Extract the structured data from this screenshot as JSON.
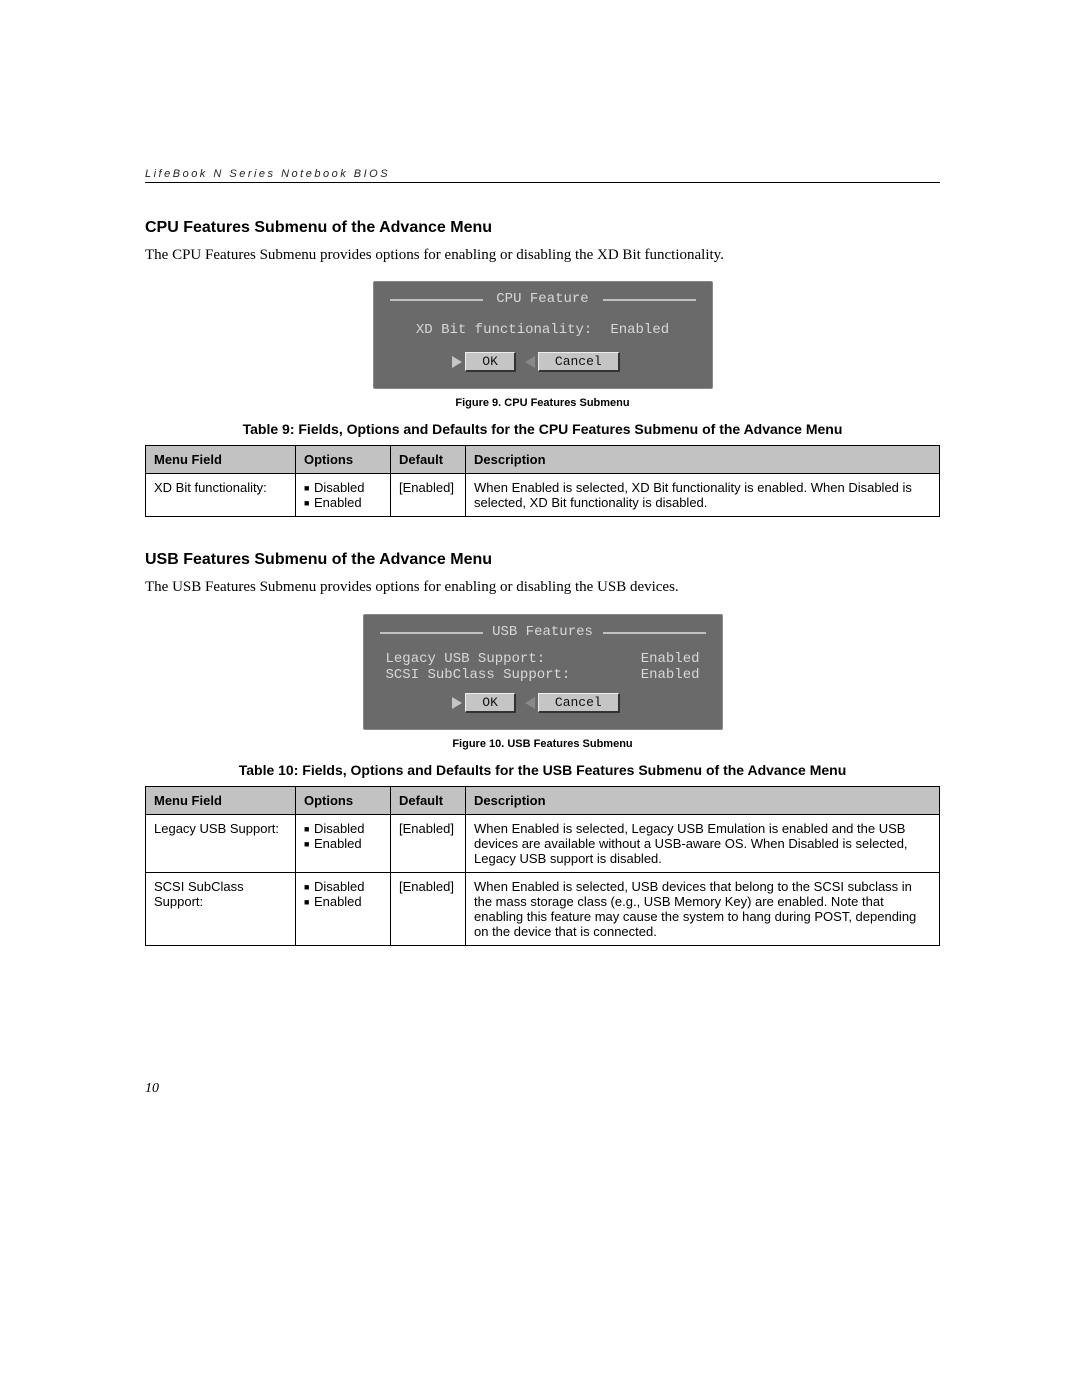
{
  "header": "LifeBook N Series Notebook BIOS",
  "section1": {
    "heading": "CPU Features Submenu of the Advance Menu",
    "body": "The CPU Features Submenu provides options for enabling or disabling the XD Bit functionality.",
    "bios": {
      "title": "CPU Feature",
      "fields": [
        {
          "label": "XD Bit functionality:",
          "value": "Enabled"
        }
      ],
      "ok": "OK",
      "cancel": "Cancel"
    },
    "fig_caption": "Figure 9.  CPU Features Submenu",
    "table_caption": "Table 9: Fields, Options and Defaults for the CPU Features Submenu of the Advance Menu",
    "table_headers": [
      "Menu Field",
      "Options",
      "Default",
      "Description"
    ],
    "table_rows": [
      {
        "field": "XD Bit functionality:",
        "options": [
          "Disabled",
          "Enabled"
        ],
        "default": "[Enabled]",
        "desc": "When Enabled is selected, XD Bit functionality is enabled. When Disabled is selected, XD Bit functionality is disabled."
      }
    ]
  },
  "section2": {
    "heading": "USB Features Submenu of the Advance Menu",
    "body": "The USB Features Submenu provides options for enabling or disabling the USB devices.",
    "bios": {
      "title": "USB Features",
      "fields": [
        {
          "label": "Legacy USB Support:",
          "value": "Enabled"
        },
        {
          "label": "SCSI SubClass Support:",
          "value": "Enabled"
        }
      ],
      "ok": "OK",
      "cancel": "Cancel"
    },
    "fig_caption": "Figure 10.  USB Features Submenu",
    "table_caption": "Table 10: Fields, Options and Defaults for the USB Features Submenu of the Advance Menu",
    "table_headers": [
      "Menu Field",
      "Options",
      "Default",
      "Description"
    ],
    "table_rows": [
      {
        "field": "Legacy USB Support:",
        "options": [
          "Disabled",
          "Enabled"
        ],
        "default": "[Enabled]",
        "desc": "When Enabled is selected, Legacy USB Emulation is enabled and the USB devices are available without a USB-aware OS. When Disabled is selected, Legacy USB support is disabled."
      },
      {
        "field": "SCSI SubClass Support:",
        "options": [
          "Disabled",
          "Enabled"
        ],
        "default": "[Enabled]",
        "desc": "When Enabled is selected, USB devices that belong to the SCSI subclass in the mass storage class (e.g., USB Memory Key) are enabled. Note that enabling this feature may cause the system to hang during POST, depending on the device that is connected."
      }
    ]
  },
  "page_number": "10"
}
